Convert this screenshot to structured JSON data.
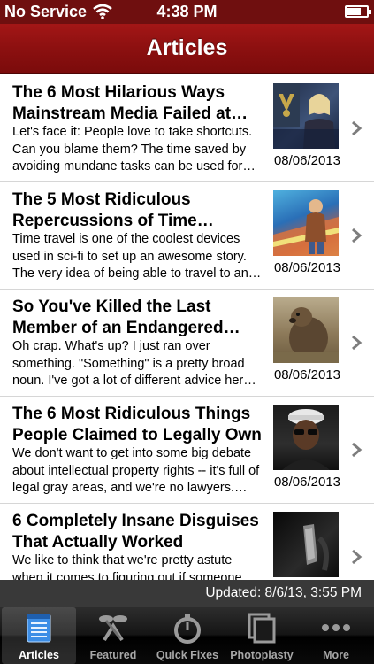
{
  "status_bar": {
    "carrier": "No Service",
    "time": "4:38 PM",
    "battery_level": 0.7,
    "icons": [
      "wifi-icon",
      "battery-icon"
    ]
  },
  "nav": {
    "title": "Articles",
    "color": "#8c1010"
  },
  "articles": [
    {
      "title": "The 6 Most Hilarious Ways Mainstream Media Failed at…",
      "summary": "Let's face it: People love to take shortcuts. Can you blame them? The time saved by avoiding mundane tasks can be used for…",
      "date": "08/06/2013",
      "thumb_icon": "news-anchor-thumbnail"
    },
    {
      "title": "The 5 Most Ridiculous Repercussions of Time Travel…",
      "summary": "Time travel is one of the coolest devices used in sci-fi to set up an awesome story. The very idea of being able to travel to an…",
      "date": "08/06/2013",
      "thumb_icon": "time-travel-poster-thumbnail"
    },
    {
      "title": "So You've Killed the Last Member of an Endangered Sp…",
      "summary": "Oh crap. What's up? I just ran over something. \"Something\" is a pretty broad noun. I've got a lot of different advice her…",
      "date": "08/06/2013",
      "thumb_icon": "groundhog-thumbnail"
    },
    {
      "title": "The 6 Most Ridiculous Things People Claimed to Legally Own",
      "summary": "We don't want to get into some big debate about intellectual property rights -- it's full of legal gray areas, and we're no lawyers.…",
      "date": "08/06/2013",
      "thumb_icon": "man-portrait-thumbnail"
    },
    {
      "title": "6 Completely Insane Disguises That Actually Worked",
      "summary": "We like to think that we're pretty astute when it comes to figuring out if someone",
      "date": "",
      "thumb_icon": "disguise-thumbnail"
    }
  ],
  "updated": "Updated: 8/6/13, 3:55 PM",
  "tabs": [
    {
      "label": "Articles",
      "icon": "notepad-icon",
      "active": true
    },
    {
      "label": "Featured",
      "icon": "featured-icon",
      "active": false
    },
    {
      "label": "Quick Fixes",
      "icon": "stopwatch-icon",
      "active": false
    },
    {
      "label": "Photoplasty",
      "icon": "photo-stack-icon",
      "active": false
    },
    {
      "label": "More",
      "icon": "more-dots-icon",
      "active": false
    }
  ]
}
